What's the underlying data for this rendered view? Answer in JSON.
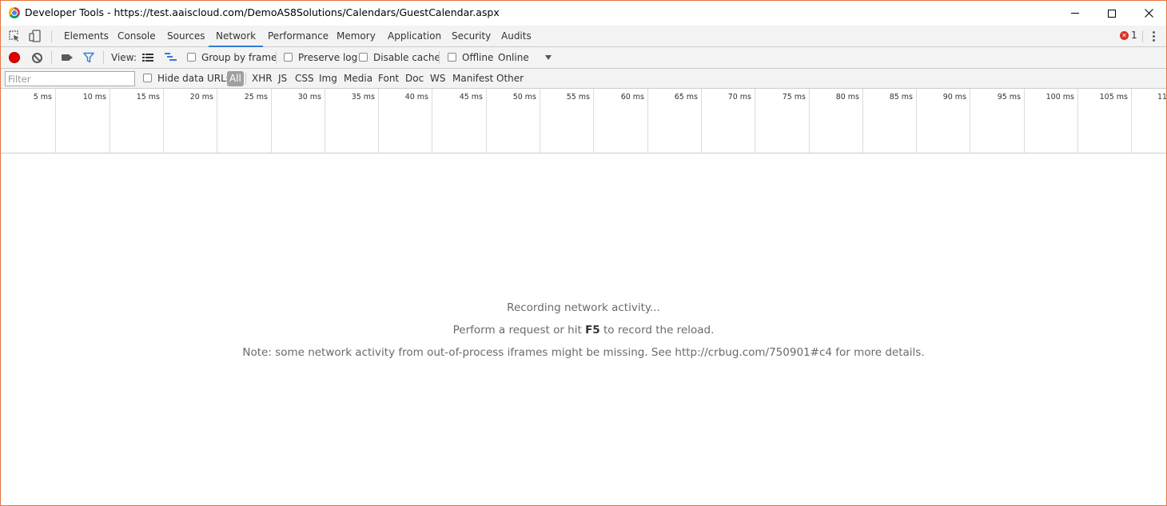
{
  "window": {
    "title": "Developer Tools - https://test.aaiscloud.com/DemoAS8Solutions/Calendars/GuestCalendar.aspx",
    "minimize_icon": "minimize-icon",
    "maximize_icon": "maximize-icon",
    "close_icon": "close-icon"
  },
  "tabs": [
    {
      "label": "Elements",
      "active": false
    },
    {
      "label": "Console",
      "active": false
    },
    {
      "label": "Sources",
      "active": false
    },
    {
      "label": "Network",
      "active": true
    },
    {
      "label": "Performance",
      "active": false
    },
    {
      "label": "Memory",
      "active": false
    },
    {
      "label": "Application",
      "active": false
    },
    {
      "label": "Security",
      "active": false
    },
    {
      "label": "Audits",
      "active": false
    }
  ],
  "errors": {
    "count": "1",
    "badge_glyph": "✕"
  },
  "toolbar": {
    "view_label": "View:",
    "group_by_frame": "Group by frame",
    "preserve_log": "Preserve log",
    "disable_cache": "Disable cache",
    "offline": "Offline",
    "throttling": "Online"
  },
  "filterbar": {
    "placeholder": "Filter",
    "hide_data_urls": "Hide data URLs",
    "types": [
      "All",
      "XHR",
      "JS",
      "CSS",
      "Img",
      "Media",
      "Font",
      "Doc",
      "WS",
      "Manifest",
      "Other"
    ]
  },
  "timeline": {
    "ticks": [
      "5 ms",
      "10 ms",
      "15 ms",
      "20 ms",
      "25 ms",
      "30 ms",
      "35 ms",
      "40 ms",
      "45 ms",
      "50 ms",
      "55 ms",
      "60 ms",
      "65 ms",
      "70 ms",
      "75 ms",
      "80 ms",
      "85 ms",
      "90 ms",
      "95 ms",
      "100 ms",
      "105 ms",
      "11"
    ]
  },
  "empty_state": {
    "line1": "Recording network activity...",
    "line2_prefix": "Perform a request or hit ",
    "line2_key": "F5",
    "line2_suffix": " to record the reload.",
    "line3": "Note: some network activity from out-of-process iframes might be missing. See http://crbug.com/750901#c4 for more details."
  },
  "colors": {
    "accent": "#3879d9",
    "record": "#e00000",
    "border": "#e3763f"
  }
}
